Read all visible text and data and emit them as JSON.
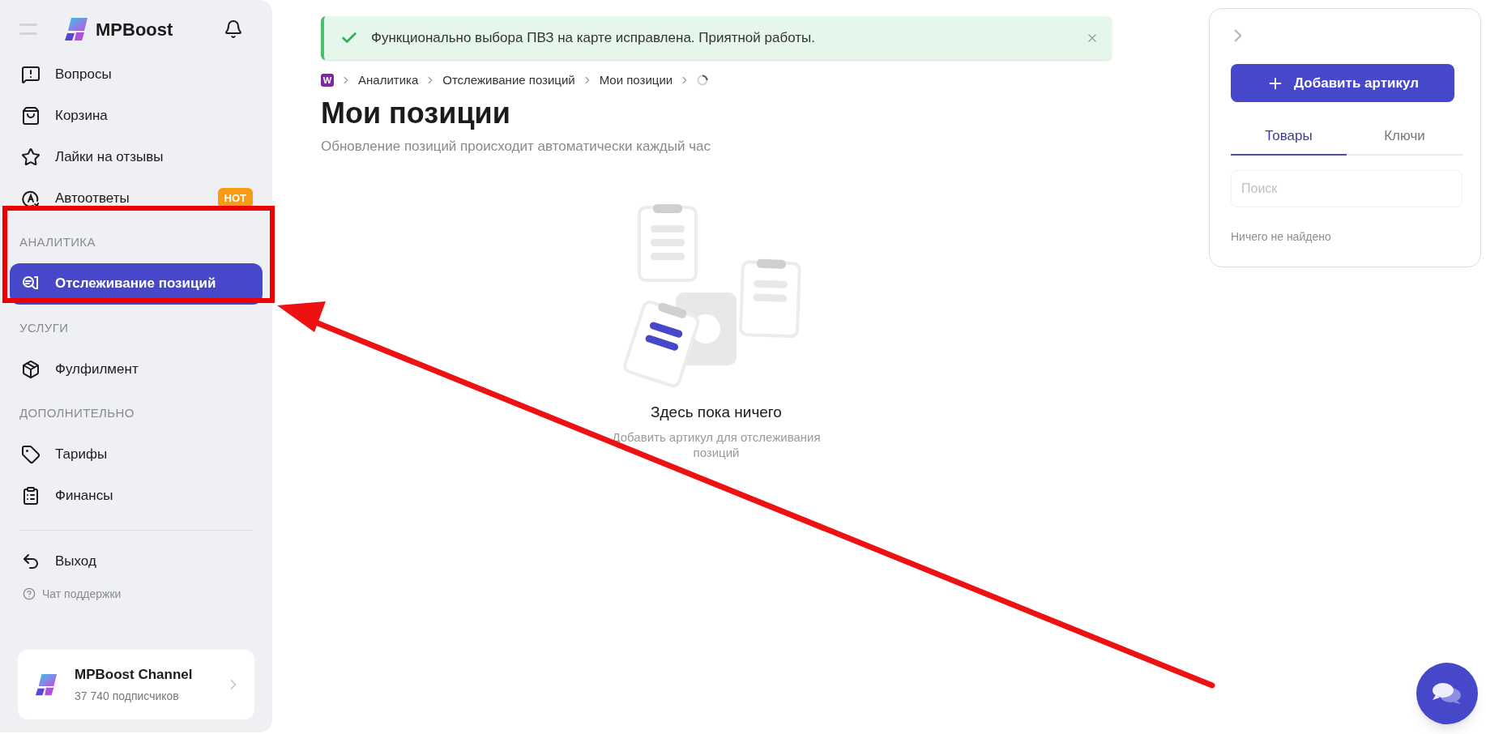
{
  "sidebar": {
    "brand": "MPBoost",
    "groups": [
      {
        "items": [
          {
            "label": "Вопросы",
            "selected": false
          },
          {
            "label": "Корзина",
            "selected": false
          },
          {
            "label": "Лайки на отзывы",
            "selected": false
          },
          {
            "label": "Автоответы",
            "selected": false,
            "badge": "HOT"
          }
        ]
      },
      {
        "heading": "АНАЛИТИКА",
        "items": [
          {
            "label": "Отслеживание позиций",
            "selected": true
          }
        ]
      },
      {
        "heading": "УСЛУГИ",
        "items": [
          {
            "label": "Фулфилмент",
            "selected": false
          }
        ]
      },
      {
        "heading": "ДОПОЛНИТЕЛЬНО",
        "items": [
          {
            "label": "Тарифы",
            "selected": false
          },
          {
            "label": "Финансы",
            "selected": false
          }
        ]
      }
    ],
    "logout": "Выход",
    "support": "Чат поддержки",
    "channel": {
      "name": "MPBoost Channel",
      "subscribers": "37 740 подписчиков"
    }
  },
  "alert": {
    "text": "Функционально выбора ПВЗ на карте исправлена. Приятной работы."
  },
  "breadcrumb": {
    "badge": "W",
    "items": [
      "Аналитика",
      "Отслеживание позиций",
      "Мои позиции"
    ]
  },
  "page": {
    "title": "Мои позиции",
    "subtitle": "Обновление позиций происходит автоматически каждый час"
  },
  "empty_state": {
    "title": "Здесь пока ничего",
    "text": "Добавить артикул для отслеживания позиций"
  },
  "panel": {
    "add_button": "Добавить артикул",
    "tabs": [
      {
        "label": "Товары",
        "selected": true
      },
      {
        "label": "Ключи",
        "selected": false
      }
    ],
    "search": {
      "placeholder": "Поиск"
    },
    "empty": "Ничего не найдено"
  }
}
